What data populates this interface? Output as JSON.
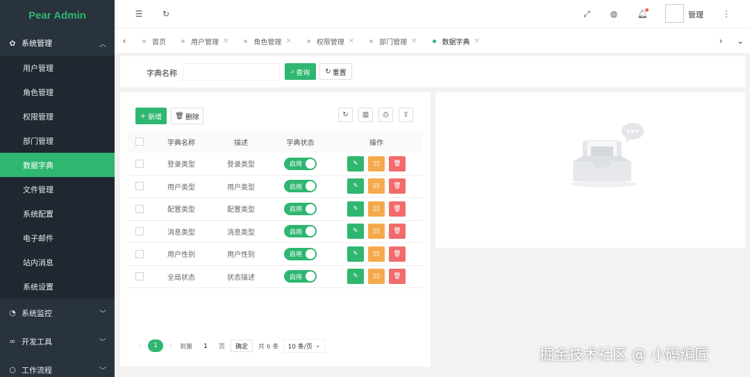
{
  "app": {
    "title": "Pear Admin"
  },
  "sidebar": {
    "group_system": {
      "label": "系统管理",
      "icon": "gear-icon"
    },
    "items": [
      {
        "label": "用户管理",
        "active": false
      },
      {
        "label": "角色管理",
        "active": false
      },
      {
        "label": "权限管理",
        "active": false
      },
      {
        "label": "部门管理",
        "active": false
      },
      {
        "label": "数据字典",
        "active": true
      },
      {
        "label": "文件管理",
        "active": false
      },
      {
        "label": "系统配置",
        "active": false
      },
      {
        "label": "电子邮件",
        "active": false
      },
      {
        "label": "站内消息",
        "active": false
      },
      {
        "label": "系统设置",
        "active": false
      }
    ],
    "groups_collapsed": [
      {
        "label": "系统监控",
        "icon": "dashboard-icon"
      },
      {
        "label": "开发工具",
        "icon": "tools-icon"
      },
      {
        "label": "工作流程",
        "icon": "workflow-icon"
      }
    ]
  },
  "header": {
    "user_name": "管理"
  },
  "tabs": [
    {
      "label": "首页",
      "active": false,
      "closable": false
    },
    {
      "label": "用户管理",
      "active": false,
      "closable": true
    },
    {
      "label": "角色管理",
      "active": false,
      "closable": true
    },
    {
      "label": "权限管理",
      "active": false,
      "closable": true
    },
    {
      "label": "部门管理",
      "active": false,
      "closable": true
    },
    {
      "label": "数据字典",
      "active": true,
      "closable": true
    }
  ],
  "search": {
    "label": "字典名称",
    "value": "",
    "query_label": "查询",
    "reset_label": "重置"
  },
  "toolbar": {
    "add_label": "新增",
    "delete_label": "删除"
  },
  "table": {
    "headers": [
      "字典名称",
      "描述",
      "字典状态",
      "操作"
    ],
    "rows": [
      {
        "name": "登录类型",
        "desc": "登录类型",
        "status": "启用"
      },
      {
        "name": "用户类型",
        "desc": "用户类型",
        "status": "启用"
      },
      {
        "name": "配置类型",
        "desc": "配置类型",
        "status": "启用"
      },
      {
        "name": "消息类型",
        "desc": "消息类型",
        "status": "启用"
      },
      {
        "name": "用户性别",
        "desc": "用户性别",
        "status": "启用"
      },
      {
        "name": "全局状态",
        "desc": "状态描述",
        "status": "启用"
      }
    ]
  },
  "pager": {
    "current": "1",
    "goto_label": "到第",
    "goto_value": "1",
    "page_unit": "页",
    "ok_label": "确定",
    "total": "共 6 条",
    "page_size": "10 条/页"
  },
  "colors": {
    "accent": "#2fb670",
    "sidebar": "#28333e",
    "warning": "#f5a94d",
    "danger": "#f16b6b"
  },
  "watermark": "掘金技术社区 @ 小码编匠"
}
